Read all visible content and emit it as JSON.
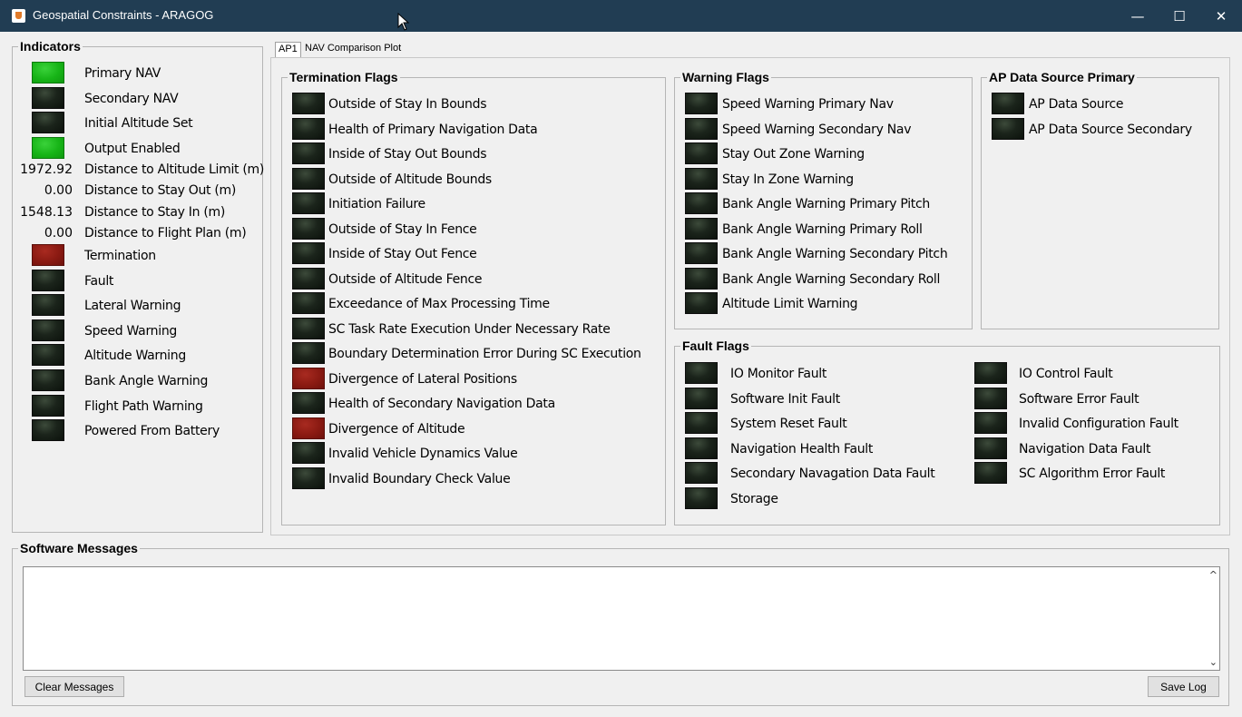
{
  "window": {
    "title": "Geospatial Constraints - ARAGOG",
    "minimize": "—",
    "maximize": "☐",
    "close": "✕"
  },
  "tabs": [
    {
      "label": "AP1",
      "active": true
    },
    {
      "label": "NAV Comparison Plot",
      "active": false
    }
  ],
  "indicators": {
    "title": "Indicators",
    "items": [
      {
        "label": "Primary NAV",
        "state": "green"
      },
      {
        "label": "Secondary NAV",
        "state": "off"
      },
      {
        "label": "Initial Altitude Set",
        "state": "off"
      },
      {
        "label": "Output Enabled",
        "state": "green"
      },
      {
        "label": "Distance to Altitude Limit (m)",
        "value": "1972.92"
      },
      {
        "label": "Distance to Stay Out (m)",
        "value": "0.00"
      },
      {
        "label": "Distance to Stay In (m)",
        "value": "1548.13"
      },
      {
        "label": "Distance to Flight Plan (m)",
        "value": "0.00"
      },
      {
        "label": "Termination",
        "state": "red"
      },
      {
        "label": "Fault",
        "state": "off"
      },
      {
        "label": "Lateral Warning",
        "state": "off"
      },
      {
        "label": "Speed Warning",
        "state": "off"
      },
      {
        "label": "Altitude Warning",
        "state": "off"
      },
      {
        "label": "Bank Angle Warning",
        "state": "off"
      },
      {
        "label": "Flight Path Warning",
        "state": "off"
      },
      {
        "label": "Powered From Battery",
        "state": "off"
      }
    ]
  },
  "termination_flags": {
    "title": "Termination Flags",
    "items": [
      {
        "label": "Outside of Stay In Bounds",
        "state": "off"
      },
      {
        "label": "Health of Primary Navigation Data",
        "state": "off"
      },
      {
        "label": "Inside of Stay Out Bounds",
        "state": "off"
      },
      {
        "label": "Outside of Altitude Bounds",
        "state": "off"
      },
      {
        "label": "Initiation Failure",
        "state": "off"
      },
      {
        "label": "Outside of Stay In Fence",
        "state": "off"
      },
      {
        "label": "Inside of Stay Out Fence",
        "state": "off"
      },
      {
        "label": "Outside of Altitude Fence",
        "state": "off"
      },
      {
        "label": "Exceedance of Max Processing Time",
        "state": "off"
      },
      {
        "label": "SC Task Rate Execution Under Necessary Rate",
        "state": "off"
      },
      {
        "label": "Boundary Determination Error During SC Execution",
        "state": "off"
      },
      {
        "label": "Divergence of Lateral Positions",
        "state": "red"
      },
      {
        "label": "Health of Secondary Navigation Data",
        "state": "off"
      },
      {
        "label": "Divergence of Altitude",
        "state": "red"
      },
      {
        "label": "Invalid Vehicle Dynamics Value",
        "state": "off"
      },
      {
        "label": "Invalid Boundary Check Value",
        "state": "off"
      }
    ]
  },
  "warning_flags": {
    "title": "Warning Flags",
    "items": [
      {
        "label": "Speed Warning Primary Nav",
        "state": "off"
      },
      {
        "label": "Speed Warning Secondary Nav",
        "state": "off"
      },
      {
        "label": "Stay Out Zone Warning",
        "state": "off"
      },
      {
        "label": "Stay In Zone Warning",
        "state": "off"
      },
      {
        "label": "Bank Angle Warning Primary Pitch",
        "state": "off"
      },
      {
        "label": "Bank Angle Warning Primary Roll",
        "state": "off"
      },
      {
        "label": "Bank Angle Warning Secondary Pitch",
        "state": "off"
      },
      {
        "label": "Bank Angle Warning Secondary Roll",
        "state": "off"
      },
      {
        "label": "Altitude Limit Warning",
        "state": "off"
      }
    ]
  },
  "ap_data_source": {
    "title": "AP Data Source Primary",
    "items": [
      {
        "label": "AP Data Source",
        "state": "off"
      },
      {
        "label": "AP Data Source Secondary",
        "state": "off"
      }
    ]
  },
  "fault_flags": {
    "title": "Fault Flags",
    "left": [
      {
        "label": "IO Monitor Fault",
        "state": "off"
      },
      {
        "label": "Software Init Fault",
        "state": "off"
      },
      {
        "label": "System Reset Fault",
        "state": "off"
      },
      {
        "label": "Navigation Health Fault",
        "state": "off"
      },
      {
        "label": "Secondary Navagation Data Fault",
        "state": "off"
      },
      {
        "label": "Storage",
        "state": "off"
      }
    ],
    "right": [
      {
        "label": "IO Control Fault",
        "state": "off"
      },
      {
        "label": "Software Error Fault",
        "state": "off"
      },
      {
        "label": "Invalid Configuration Fault",
        "state": "off"
      },
      {
        "label": "Navigation Data Fault",
        "state": "off"
      },
      {
        "label": "SC Algorithm Error Fault",
        "state": "off"
      }
    ]
  },
  "software_messages": {
    "title": "Software Messages",
    "text": "",
    "clear_label": "Clear Messages",
    "save_label": "Save Log"
  }
}
